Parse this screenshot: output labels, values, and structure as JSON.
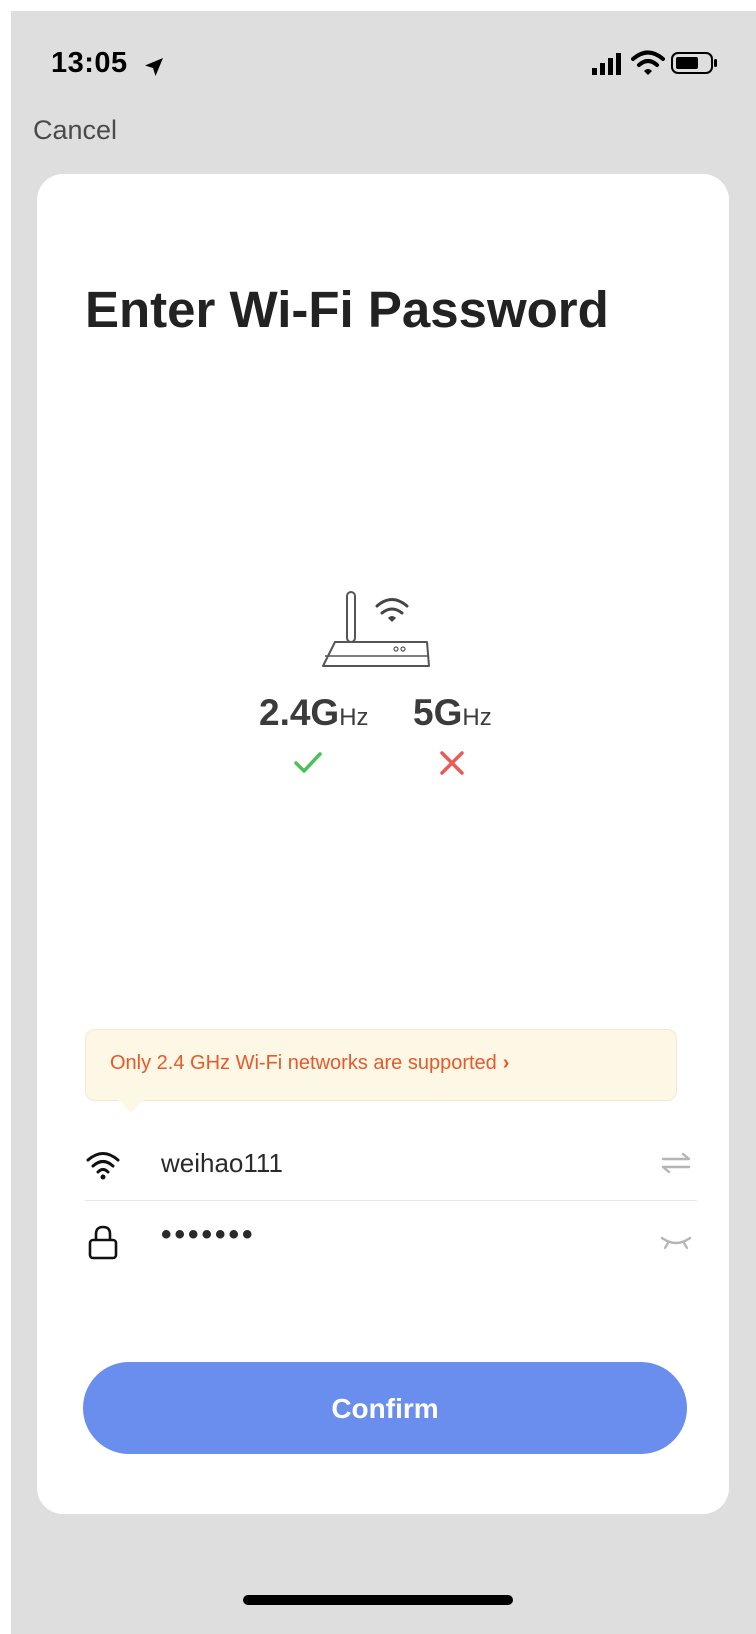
{
  "status_bar": {
    "time": "13:05",
    "icons": [
      "location-arrow-icon",
      "signal-icon",
      "wifi-icon",
      "battery-icon"
    ]
  },
  "nav": {
    "cancel_label": "Cancel"
  },
  "card": {
    "title": "Enter Wi-Fi Password",
    "router_icon": "router-icon",
    "bands": [
      {
        "value": "2.4G",
        "unit": "Hz",
        "supported": true,
        "status_icon": "check-icon",
        "color": "#4cc15a"
      },
      {
        "value": "5G",
        "unit": "Hz",
        "supported": false,
        "status_icon": "cross-icon",
        "color": "#ec5a55"
      }
    ],
    "tip": {
      "text": "Only 2.4 GHz Wi-Fi networks are supported",
      "chevron": "›",
      "color": "#e8592a"
    },
    "ssid": {
      "icon": "wifi-icon",
      "value": "weihao111",
      "action_icon": "switch-network-icon"
    },
    "password": {
      "icon": "lock-icon",
      "value": "•••••••",
      "action_icon": "eye-closed-icon"
    },
    "confirm_label": "Confirm",
    "accent_color": "#6a8eee"
  }
}
